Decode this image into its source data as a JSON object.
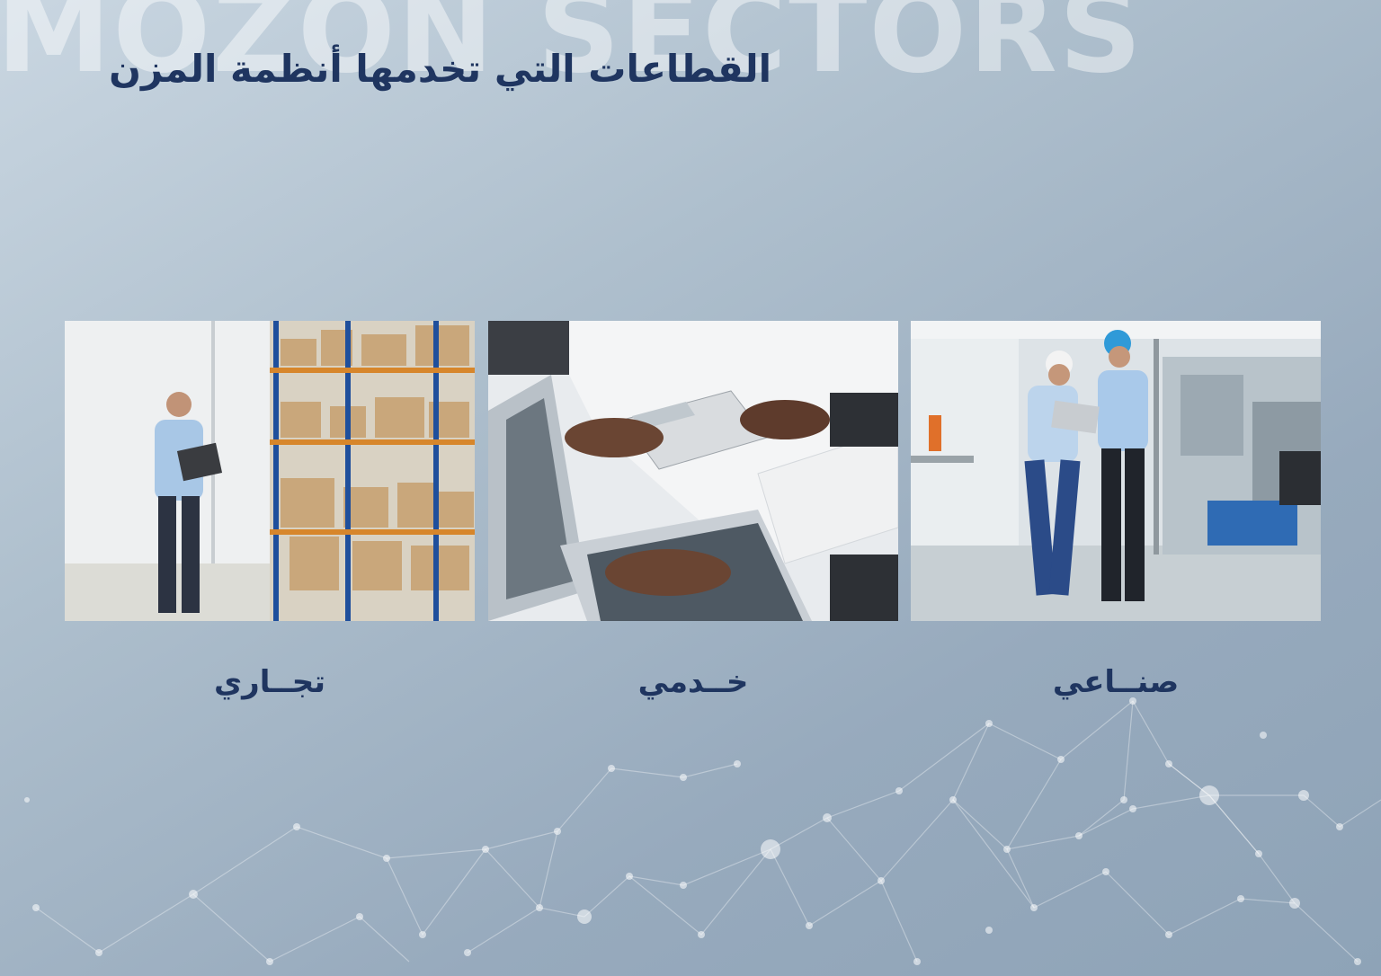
{
  "watermark": "MOZON SECTORS",
  "title": "القطاعات التي تخدمها أنظمة المزن",
  "sectors": [
    {
      "label": "تجــاري",
      "photo": "warehouse-photo"
    },
    {
      "label": "خــدمي",
      "photo": "office-photo"
    },
    {
      "label": "صنــاعي",
      "photo": "factory-photo"
    }
  ],
  "colors": {
    "title": "#1f3560",
    "background": "#aebfcd"
  }
}
